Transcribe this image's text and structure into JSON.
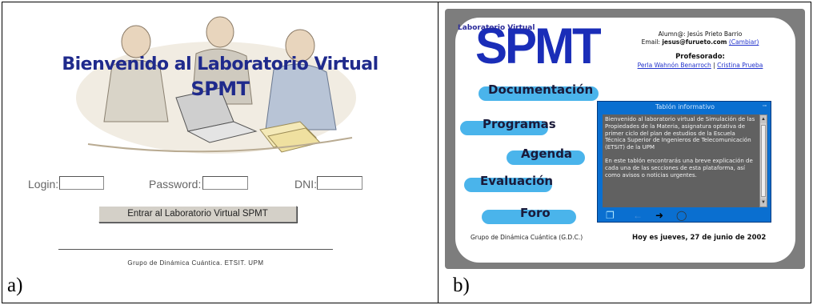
{
  "figure": {
    "panel_a_label": "a)",
    "panel_b_label": "b)"
  },
  "panel_a": {
    "title_line1": "Bienvenido al Laboratorio Virtual",
    "title_line2": "SPMT",
    "login_label": "Login:",
    "login_value": "",
    "password_label": "Password:",
    "password_value": "",
    "dni_label": "DNI:",
    "dni_value": "",
    "enter_button": "Entrar al Laboratorio Virtual SPMT",
    "footer": "Grupo de Dinámica Cuántica. ETSIT. UPM",
    "title_color": "#1f2a8c"
  },
  "panel_b": {
    "lab_label": "Laboratorio Virtual",
    "logo": "SPMT",
    "student_label": "Alumn@: Jesús Prieto Barrio",
    "email_label": "Email:",
    "email_value": "jesus@furueto.com",
    "change_link": "(Cambiar)",
    "professor_heading": "Profesorado:",
    "professor_1": "Perla Wahnón Benarroch",
    "professor_separator": "|",
    "professor_2": "Cristina Prueba",
    "nav": {
      "documentacion": "Documentación",
      "programas": "Programas",
      "agenda": "Agenda",
      "evaluacion": "Evaluación",
      "foro": "Foro"
    },
    "notice_title": "Tablón informativo",
    "notice_paragraph_1": "Bienvenido al laboratorio virtual de Simulación de las Propiedades de la Materia, asignatura optativa de primer ciclo del plan de estudios de la Escuela Técnica Superior de Ingenieros de Telecomunicación (ETSIT) de la UPM",
    "notice_paragraph_2": "En este tablón encontrarás una breve explicación de cada una de las secciones de esta plataforma, así como avisos o noticias urgentes.",
    "credit": "Grupo de Dinámica Cuántica (G.D.C.)",
    "date": "Hoy es jueves, 27 de junio de 2002",
    "logo_color": "#1a2db8",
    "brush_color": "#2aa7e8",
    "notice_color": "#0a6fd0"
  }
}
